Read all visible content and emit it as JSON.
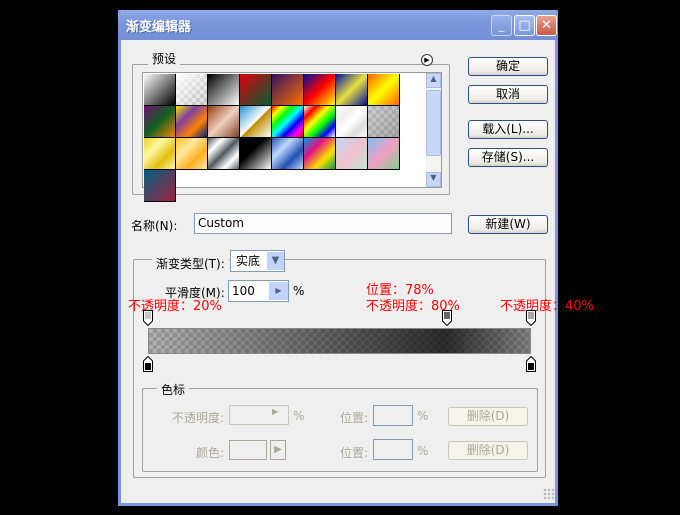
{
  "window": {
    "title": "渐变编辑器"
  },
  "presets": {
    "label": "预设",
    "swatches": [
      "linear-gradient(135deg,#fff,#000)",
      "linear-gradient(135deg,#fff,rgba(255,255,255,0))",
      "linear-gradient(135deg,#000,#fff)",
      "linear-gradient(135deg,#e00010,#006030)",
      "linear-gradient(135deg,#301060,#ff7000)",
      "linear-gradient(135deg,#0010a0,#ff0000,#ffff00)",
      "linear-gradient(135deg,#0010a0,#e8e040,#0010a0)",
      "linear-gradient(135deg,#ff6000,#ffff00,#ff6000)",
      "linear-gradient(135deg,#701070,#106020,#ff8000)",
      "linear-gradient(135deg,#ffe000,#8040a0,#ff8000,#002080)",
      "linear-gradient(135deg,#904010,#f0d0c0,#804020)",
      "linear-gradient(135deg,#2090d0,#fff 50%,#c09000 52%,#fff)",
      "linear-gradient(135deg,#ff0000,#ffff00,#00ff00,#00ffff,#0000ff,#ff00ff,#ff0000)",
      "linear-gradient(135deg,#fff,#ff0000,#ffff00,#00ff00,#0000ff,#fff)",
      "linear-gradient(135deg,#fff,#eee,#fff,#ddd,#fff)",
      "linear-gradient(135deg,rgba(180,180,180,.3),rgba(120,120,120,.5))",
      "linear-gradient(135deg,#e8d020,#fff8a0,#e0c010,#fff8a0)",
      "linear-gradient(135deg,#ffc030,#ffe8a0,#ffb020,#ffe8a0)",
      "linear-gradient(135deg,#505a60,#fff,#505a60,#fff,#505a60)",
      "linear-gradient(135deg,#000,#000 40%,#fff)",
      "linear-gradient(135deg,#2050b0,#c0d8ff,#2050b0,#c0d8ff)",
      "linear-gradient(135deg,#00a0e0,#e01080,#ffe000,#00a040)",
      "linear-gradient(135deg,#c0d8f0,#f0c0d0,#c0e8d0)",
      "linear-gradient(135deg,#80c0f0,#f0a0c0,#80d090)",
      "linear-gradient(135deg,#006080,#a02040)"
    ]
  },
  "buttons": {
    "ok": "确定",
    "cancel": "取消",
    "load": "载入(L)...",
    "save": "存储(S)...",
    "new": "新建(W)"
  },
  "name": {
    "label": "名称(N):",
    "value": "Custom"
  },
  "gradient": {
    "type_label": "渐变类型(T):",
    "type_value": "实底",
    "smooth_label": "平滑度(M):",
    "smooth_value": "100",
    "smooth_unit": "%",
    "annotations": {
      "left": "不透明度：20%",
      "mid_pos": "位置：78%",
      "mid_opacity": "不透明度：80%",
      "right": "不透明度：40%"
    },
    "opacity_stops": [
      {
        "location": 0,
        "opacity": 20
      },
      {
        "location": 78,
        "opacity": 80
      },
      {
        "location": 100,
        "opacity": 40
      }
    ],
    "color_stops": [
      {
        "location": 0,
        "color": "#000000"
      },
      {
        "location": 100,
        "color": "#000000"
      }
    ]
  },
  "stops": {
    "label": "色标",
    "opacity_label": "不透明度:",
    "pct": "%",
    "position_label": "位置:",
    "delete": "删除(D)",
    "color_label": "颜色:"
  },
  "colors": {
    "titlebar": "#7b97dc",
    "annotation": "#ff0000"
  }
}
